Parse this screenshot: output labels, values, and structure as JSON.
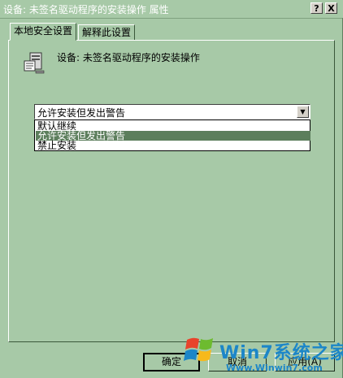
{
  "window": {
    "title": "设备: 未签名驱动程序的安装操作 属性",
    "help_button": "?",
    "close_button": "X"
  },
  "tabs": [
    {
      "label": "本地安全设置",
      "active": true
    },
    {
      "label": "解释此设置",
      "active": false
    }
  ],
  "policy": {
    "icon": "policy-computer-icon",
    "name": "设备: 未签名驱动程序的安装操作"
  },
  "combo": {
    "value": "允许安装但发出警告",
    "options": [
      {
        "label": "默认继续",
        "selected": false
      },
      {
        "label": "允许安装但发出警告",
        "selected": true
      },
      {
        "label": "禁止安装",
        "selected": false
      }
    ]
  },
  "buttons": {
    "ok": "确定",
    "cancel": "取消",
    "apply": "应用(A)"
  },
  "watermark": {
    "brand": "Win7系统之家",
    "url": "Www.Winwin7.com"
  },
  "colors": {
    "background": "#a7c9a7",
    "selection": "#5c7e5c",
    "watermark_blue": "#1c86c8"
  }
}
